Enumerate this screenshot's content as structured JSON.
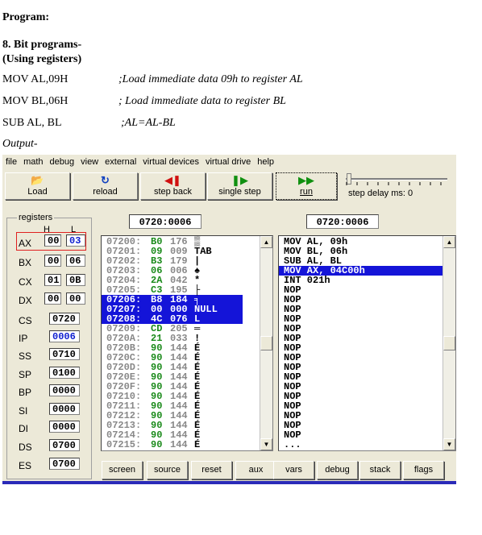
{
  "doc": {
    "program_label": "Program:",
    "section_title": "8. Bit programs-",
    "section_subtitle": "(Using registers)",
    "code": [
      {
        "instr": "MOV AL,09H",
        "comment": ";Load immediate data 09h to register AL"
      },
      {
        "instr": "MOV BL,06H",
        "comment": "; Load immediate data to register BL"
      },
      {
        "instr": "SUB AL, BL",
        "comment": ";AL=AL-BL"
      }
    ],
    "output_label": "Output-"
  },
  "emulator": {
    "menu": [
      "file",
      "math",
      "debug",
      "view",
      "external",
      "virtual devices",
      "virtual drive",
      "help"
    ],
    "toolbar": {
      "load": "Load",
      "reload": "reload",
      "step_back": "step back",
      "single_step": "single step",
      "run": "run",
      "step_delay": "step delay ms: 0"
    },
    "registers": {
      "title": "registers",
      "h_label": "H",
      "l_label": "L",
      "ax": {
        "name": "AX",
        "h": "00",
        "l": "03"
      },
      "bx": {
        "name": "BX",
        "h": "00",
        "l": "06"
      },
      "cx": {
        "name": "CX",
        "h": "01",
        "l": "0B"
      },
      "dx": {
        "name": "DX",
        "h": "00",
        "l": "00"
      },
      "cs": {
        "name": "CS",
        "value": "0720"
      },
      "ip": {
        "name": "IP",
        "value": "0006"
      },
      "ss": {
        "name": "SS",
        "value": "0710"
      },
      "sp": {
        "name": "SP",
        "value": "0100"
      },
      "bp": {
        "name": "BP",
        "value": "0000"
      },
      "si": {
        "name": "SI",
        "value": "0000"
      },
      "di": {
        "name": "DI",
        "value": "0000"
      },
      "ds": {
        "name": "DS",
        "value": "0700"
      },
      "es": {
        "name": "ES",
        "value": "0700"
      }
    },
    "memory_address": "0720:0006",
    "disasm_address": "0720:0006",
    "memory": [
      {
        "addr": "07200:",
        "hex": "B0",
        "dec": "176",
        "chr": "▒"
      },
      {
        "addr": "07201:",
        "hex": "09",
        "dec": "009",
        "chr": "TAB"
      },
      {
        "addr": "07202:",
        "hex": "B3",
        "dec": "179",
        "chr": "|"
      },
      {
        "addr": "07203:",
        "hex": "06",
        "dec": "006",
        "chr": "♠"
      },
      {
        "addr": "07204:",
        "hex": "2A",
        "dec": "042",
        "chr": "*"
      },
      {
        "addr": "07205:",
        "hex": "C3",
        "dec": "195",
        "chr": "├"
      },
      {
        "addr": "07206:",
        "hex": "B8",
        "dec": "184",
        "chr": "╕",
        "sel": true
      },
      {
        "addr": "07207:",
        "hex": "00",
        "dec": "000",
        "chr": "NULL",
        "sel": true
      },
      {
        "addr": "07208:",
        "hex": "4C",
        "dec": "076",
        "chr": "L",
        "sel": true
      },
      {
        "addr": "07209:",
        "hex": "CD",
        "dec": "205",
        "chr": "═"
      },
      {
        "addr": "0720A:",
        "hex": "21",
        "dec": "033",
        "chr": "!"
      },
      {
        "addr": "0720B:",
        "hex": "90",
        "dec": "144",
        "chr": "É"
      },
      {
        "addr": "0720C:",
        "hex": "90",
        "dec": "144",
        "chr": "É"
      },
      {
        "addr": "0720D:",
        "hex": "90",
        "dec": "144",
        "chr": "É"
      },
      {
        "addr": "0720E:",
        "hex": "90",
        "dec": "144",
        "chr": "É"
      },
      {
        "addr": "0720F:",
        "hex": "90",
        "dec": "144",
        "chr": "É"
      },
      {
        "addr": "07210:",
        "hex": "90",
        "dec": "144",
        "chr": "É"
      },
      {
        "addr": "07211:",
        "hex": "90",
        "dec": "144",
        "chr": "É"
      },
      {
        "addr": "07212:",
        "hex": "90",
        "dec": "144",
        "chr": "É"
      },
      {
        "addr": "07213:",
        "hex": "90",
        "dec": "144",
        "chr": "É"
      },
      {
        "addr": "07214:",
        "hex": "90",
        "dec": "144",
        "chr": "É"
      },
      {
        "addr": "07215:",
        "hex": "90",
        "dec": "144",
        "chr": "É"
      }
    ],
    "disasm": [
      {
        "text": "MOV AL, 09h"
      },
      {
        "text": "MOV BL, 06h"
      },
      {
        "text": "SUB AL, BL"
      },
      {
        "text": "MOV AX, 04C00h",
        "sel": true
      },
      {
        "text": "INT 021h"
      },
      {
        "text": "NOP"
      },
      {
        "text": "NOP"
      },
      {
        "text": "NOP"
      },
      {
        "text": "NOP"
      },
      {
        "text": "NOP"
      },
      {
        "text": "NOP"
      },
      {
        "text": "NOP"
      },
      {
        "text": "NOP"
      },
      {
        "text": "NOP"
      },
      {
        "text": "NOP"
      },
      {
        "text": "NOP"
      },
      {
        "text": "NOP"
      },
      {
        "text": "NOP"
      },
      {
        "text": "NOP"
      },
      {
        "text": "NOP"
      },
      {
        "text": "NOP"
      },
      {
        "text": "..."
      }
    ],
    "bottom_buttons": [
      "screen",
      "source",
      "reset",
      "aux",
      "vars",
      "debug",
      "stack",
      "flags"
    ],
    "colors": {
      "selection": "#1414d8",
      "hex_values": "#1a8a1a",
      "register_changed": "#1020d0",
      "highlight_box": "#e02020"
    }
  }
}
